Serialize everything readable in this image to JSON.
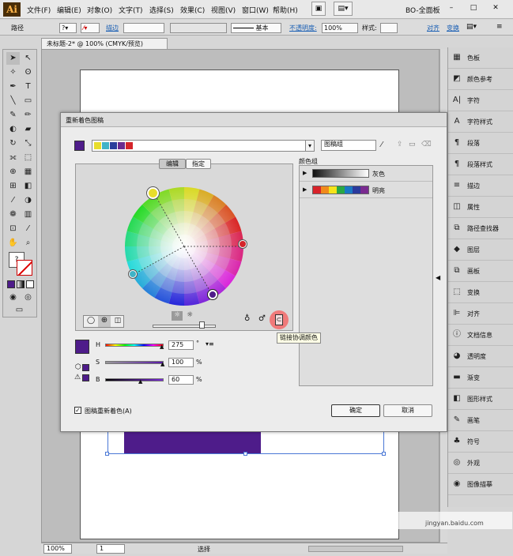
{
  "app": {
    "logo": "Ai",
    "workspace": "BO-全面板"
  },
  "menu": [
    "文件(F)",
    "编辑(E)",
    "对象(O)",
    "文字(T)",
    "选择(S)",
    "效果(C)",
    "视图(V)",
    "窗口(W)",
    "帮助(H)"
  ],
  "control": {
    "label": "路径",
    "stroke_label": "描边",
    "basic": "基本",
    "opacity_label": "不透明度:",
    "opacity": "100%",
    "style_label": "样式:",
    "align": "对齐",
    "transform": "变换"
  },
  "document": {
    "tab": "未标题-2* @ 100% (CMYK/预览)",
    "zoom": "100%",
    "page": "1",
    "status": "选择"
  },
  "panels": [
    "色板",
    "颜色参考",
    "字符",
    "字符样式",
    "段落",
    "段落样式",
    "描边",
    "属性",
    "路径查找器",
    "图层",
    "画板",
    "变换",
    "对齐",
    "文档信息",
    "透明度",
    "渐变",
    "图形样式",
    "画笔",
    "符号",
    "外观",
    "图像描摹"
  ],
  "dialog": {
    "title": "重新着色图稿",
    "group_name": "图稿组",
    "tabs": [
      "编辑",
      "指定"
    ],
    "groups_label": "颜色组",
    "groups": [
      {
        "name": "灰色"
      },
      {
        "name": "明亮"
      }
    ],
    "hsb": {
      "h_label": "H",
      "h": "275",
      "deg": "°",
      "s_label": "S",
      "s": "100",
      "b_label": "B",
      "b": "60",
      "pct": "%"
    },
    "recolor_checkbox": "图稿重新着色(A)",
    "ok": "确定",
    "cancel": "取消",
    "tooltip": "链接协调颜色"
  },
  "colors": {
    "base": "#4e1c8a",
    "strip": [
      "#e8dd2b",
      "#3fb3c7",
      "#2b3f9c",
      "#6a2a90",
      "#d4242a"
    ],
    "bright": [
      "#d8232a",
      "#f08a1c",
      "#f5e31a",
      "#28a845",
      "#1a78c4",
      "#2b3a9c",
      "#7a2a90"
    ]
  },
  "watermark": "jingyan.baidu.com"
}
